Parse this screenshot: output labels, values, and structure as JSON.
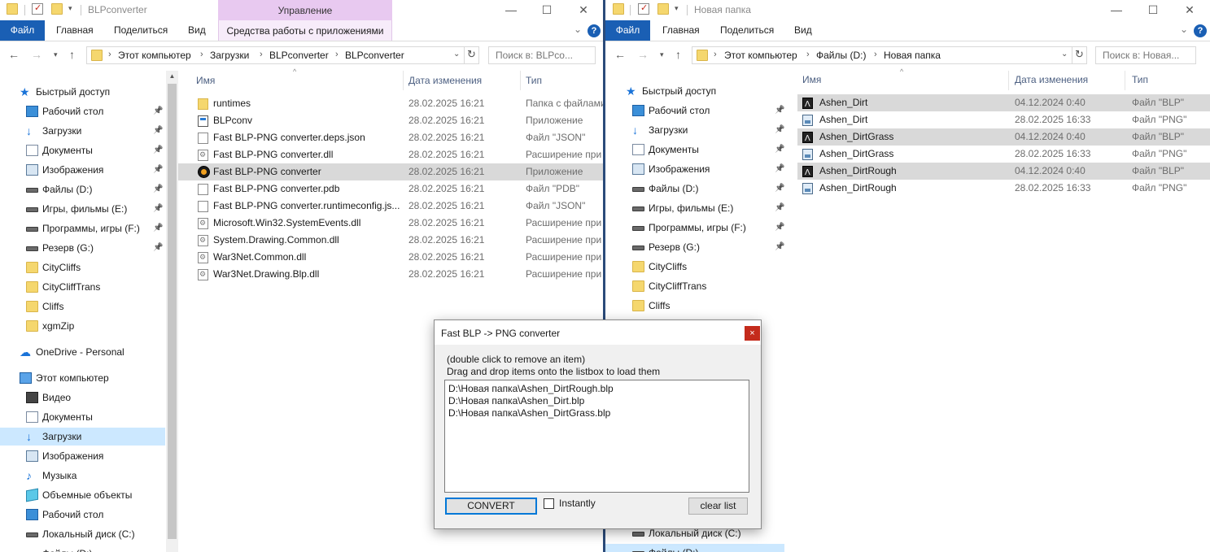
{
  "left_window": {
    "title": "BLPconverter",
    "context_tab_header": "Управление",
    "ribbon_tabs": {
      "file": "Файл",
      "home": "Главная",
      "share": "Поделиться",
      "view": "Вид",
      "app_tools": "Средства работы с приложениями"
    },
    "address": {
      "crumbs": [
        "Этот компьютер",
        "Загрузки",
        "BLPconverter",
        "BLPconverter"
      ]
    },
    "search_placeholder": "Поиск в: BLPco...",
    "nav": [
      {
        "label": "Быстрый доступ",
        "icon": "star-icon",
        "pinned": false
      },
      {
        "label": "Рабочий стол",
        "icon": "desktop-icon",
        "pinned": true
      },
      {
        "label": "Загрузки",
        "icon": "download-icon",
        "pinned": true
      },
      {
        "label": "Документы",
        "icon": "document-icon",
        "pinned": true
      },
      {
        "label": "Изображения",
        "icon": "image-icon",
        "pinned": true
      },
      {
        "label": "Файлы (D:)",
        "icon": "drive-icon",
        "pinned": true
      },
      {
        "label": "Игры, фильмы (E:)",
        "icon": "drive-icon",
        "pinned": true
      },
      {
        "label": "Программы, игры (F:)",
        "icon": "drive-icon",
        "pinned": true
      },
      {
        "label": "Резерв (G:)",
        "icon": "drive-icon",
        "pinned": true
      },
      {
        "label": "CityCliffs",
        "icon": "folder-icon",
        "pinned": false
      },
      {
        "label": "CityCliffTrans",
        "icon": "folder-icon",
        "pinned": false
      },
      {
        "label": "Cliffs",
        "icon": "folder-icon",
        "pinned": false
      },
      {
        "label": "xgmZip",
        "icon": "folder-icon",
        "pinned": false
      },
      {
        "label": "OneDrive - Personal",
        "icon": "cloud-icon",
        "pinned": false
      },
      {
        "label": "Этот компьютер",
        "icon": "computer-icon",
        "pinned": false
      },
      {
        "label": "Видео",
        "icon": "video-icon",
        "pinned": false
      },
      {
        "label": "Документы",
        "icon": "document-icon",
        "pinned": false
      },
      {
        "label": "Загрузки",
        "icon": "download-icon",
        "pinned": false,
        "selected": true
      },
      {
        "label": "Изображения",
        "icon": "image-icon",
        "pinned": false
      },
      {
        "label": "Музыка",
        "icon": "music-icon",
        "pinned": false
      },
      {
        "label": "Объемные объекты",
        "icon": "3d-objects-icon",
        "pinned": false
      },
      {
        "label": "Рабочий стол",
        "icon": "desktop-icon",
        "pinned": false
      },
      {
        "label": "Локальный диск (C:)",
        "icon": "drive-icon",
        "pinned": false
      },
      {
        "label": "Файлы (D:)",
        "icon": "drive-icon",
        "pinned": false
      }
    ],
    "columns": {
      "name": "Имя",
      "date": "Дата изменения",
      "type": "Тип"
    },
    "files": [
      {
        "name": "runtimes",
        "date": "28.02.2025 16:21",
        "type": "Папка с файлами",
        "icon": "folder-icon"
      },
      {
        "name": "BLPconv",
        "date": "28.02.2025 16:21",
        "type": "Приложение",
        "icon": "app-icon"
      },
      {
        "name": "Fast BLP-PNG converter.deps.json",
        "date": "28.02.2025 16:21",
        "type": "Файл \"JSON\"",
        "icon": "file-icon"
      },
      {
        "name": "Fast BLP-PNG converter.dll",
        "date": "28.02.2025 16:21",
        "type": "Расширение при",
        "icon": "dll-icon"
      },
      {
        "name": "Fast BLP-PNG converter",
        "date": "28.02.2025 16:21",
        "type": "Приложение",
        "icon": "exe-icon",
        "selected": true
      },
      {
        "name": "Fast BLP-PNG converter.pdb",
        "date": "28.02.2025 16:21",
        "type": "Файл \"PDB\"",
        "icon": "file-icon"
      },
      {
        "name": "Fast BLP-PNG converter.runtimeconfig.js...",
        "date": "28.02.2025 16:21",
        "type": "Файл \"JSON\"",
        "icon": "file-icon"
      },
      {
        "name": "Microsoft.Win32.SystemEvents.dll",
        "date": "28.02.2025 16:21",
        "type": "Расширение при",
        "icon": "dll-icon"
      },
      {
        "name": "System.Drawing.Common.dll",
        "date": "28.02.2025 16:21",
        "type": "Расширение при",
        "icon": "dll-icon"
      },
      {
        "name": "War3Net.Common.dll",
        "date": "28.02.2025 16:21",
        "type": "Расширение при",
        "icon": "dll-icon"
      },
      {
        "name": "War3Net.Drawing.Blp.dll",
        "date": "28.02.2025 16:21",
        "type": "Расширение при",
        "icon": "dll-icon"
      }
    ]
  },
  "right_window": {
    "title": "Новая папка",
    "ribbon_tabs": {
      "file": "Файл",
      "home": "Главная",
      "share": "Поделиться",
      "view": "Вид"
    },
    "address": {
      "crumbs": [
        "Этот компьютер",
        "Файлы (D:)",
        "Новая папка"
      ]
    },
    "search_placeholder": "Поиск в: Новая...",
    "nav": [
      {
        "label": "Быстрый доступ",
        "icon": "star-icon",
        "pinned": false
      },
      {
        "label": "Рабочий стол",
        "icon": "desktop-icon",
        "pinned": true
      },
      {
        "label": "Загрузки",
        "icon": "download-icon",
        "pinned": true
      },
      {
        "label": "Документы",
        "icon": "document-icon",
        "pinned": true
      },
      {
        "label": "Изображения",
        "icon": "image-icon",
        "pinned": true
      },
      {
        "label": "Файлы (D:)",
        "icon": "drive-icon",
        "pinned": true
      },
      {
        "label": "Игры, фильмы (E:)",
        "icon": "drive-icon",
        "pinned": true
      },
      {
        "label": "Программы, игры (F:)",
        "icon": "drive-icon",
        "pinned": true
      },
      {
        "label": "Резерв (G:)",
        "icon": "drive-icon",
        "pinned": true
      },
      {
        "label": "CityCliffs",
        "icon": "folder-icon",
        "pinned": false
      },
      {
        "label": "CityCliffTrans",
        "icon": "folder-icon",
        "pinned": false
      },
      {
        "label": "Cliffs",
        "icon": "folder-icon",
        "pinned": false
      },
      {
        "label": "Локальный диск (C:)",
        "icon": "drive-icon",
        "pinned": false
      },
      {
        "label": "Файлы (D:)",
        "icon": "drive-icon",
        "pinned": false,
        "selected": true
      }
    ],
    "columns": {
      "name": "Имя",
      "date": "Дата изменения",
      "type": "Тип"
    },
    "files": [
      {
        "name": "Ashen_Dirt",
        "date": "04.12.2024 0:40",
        "type": "Файл \"BLP\"",
        "icon": "blp-icon",
        "selected": true
      },
      {
        "name": "Ashen_Dirt",
        "date": "28.02.2025 16:33",
        "type": "Файл \"PNG\"",
        "icon": "png-icon"
      },
      {
        "name": "Ashen_DirtGrass",
        "date": "04.12.2024 0:40",
        "type": "Файл \"BLP\"",
        "icon": "blp-icon",
        "selected": true
      },
      {
        "name": "Ashen_DirtGrass",
        "date": "28.02.2025 16:33",
        "type": "Файл \"PNG\"",
        "icon": "png-icon"
      },
      {
        "name": "Ashen_DirtRough",
        "date": "04.12.2024 0:40",
        "type": "Файл \"BLP\"",
        "icon": "blp-icon",
        "selected": true
      },
      {
        "name": "Ashen_DirtRough",
        "date": "28.02.2025 16:33",
        "type": "Файл \"PNG\"",
        "icon": "png-icon"
      }
    ]
  },
  "dialog": {
    "title": "Fast BLP -> PNG converter",
    "close_glyph": "×",
    "hint_line1": "(double click to remove an item)",
    "hint_line2": "Drag and drop items onto the listbox to load them",
    "items": [
      "D:\\Новая папка\\Ashen_DirtRough.blp",
      "D:\\Новая папка\\Ashen_Dirt.blp",
      "D:\\Новая папка\\Ashen_DirtGrass.blp"
    ],
    "convert_label": "CONVERT",
    "instantly_label": "Instantly",
    "instantly_checked": false,
    "clear_label": "clear list"
  },
  "colors": {
    "accent_blue": "#1a5fb4",
    "manage_tab": "#e8c9f0",
    "selection_gray": "#d9d9d9",
    "nav_selection": "#cce8ff",
    "close_red": "#c42b1c"
  }
}
